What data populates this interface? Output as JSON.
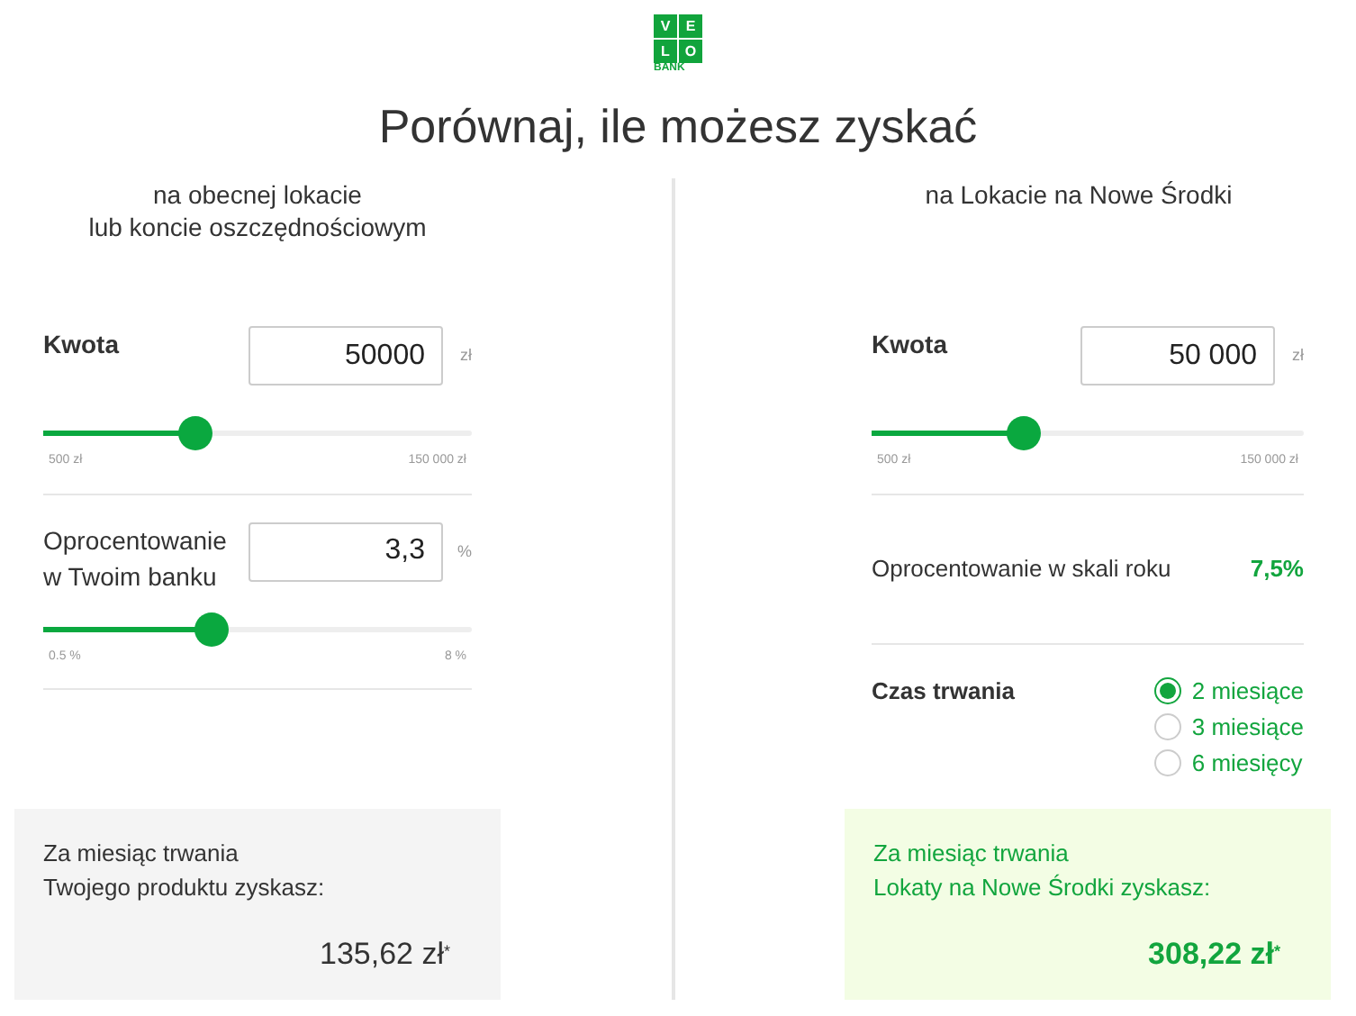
{
  "logo": {
    "letters": [
      "V",
      "E",
      "L",
      "O"
    ],
    "subtitle": "BANK"
  },
  "title": "Porównaj, ile możesz zyskać",
  "left": {
    "heading": [
      "na obecnej lokacie",
      "lub koncie oszczędnościowym"
    ],
    "fields": [
      {
        "label": "Kwota",
        "value": "50000",
        "unit": "zł",
        "level": 0.34,
        "min": "500 zł",
        "max": "150 000 zł"
      },
      {
        "label": "Oprocentowanie\nw Twoim banku",
        "value": "3,3",
        "unit": "%",
        "level": 0.38,
        "min": "0.5 %",
        "max": "8 %"
      }
    ],
    "result": {
      "lines": [
        "Za miesiąc trwania",
        "Twojego produktu zyskasz:"
      ],
      "amount": "135,62 zł",
      "mark": "*"
    }
  },
  "right": {
    "heading": "na Lokacie na Nowe Środki",
    "field": {
      "label": "Kwota",
      "value": "50 000",
      "unit": "zł",
      "level": 0.34,
      "min": "500 zł",
      "max": "150 000 zł"
    },
    "rate": {
      "label": "Oprocentowanie w skali roku",
      "value": "7,5%"
    },
    "duration": {
      "label": "Czas trwania",
      "options": [
        {
          "label": "2 miesiące",
          "selected": true
        },
        {
          "label": "3 miesiące",
          "selected": false
        },
        {
          "label": "6 miesięcy",
          "selected": false
        }
      ]
    },
    "result": {
      "lines": [
        "Za miesiąc trwania",
        "Lokaty na Nowe Środki zyskasz:"
      ],
      "amount": "308,22 zł",
      "mark": "*"
    }
  }
}
